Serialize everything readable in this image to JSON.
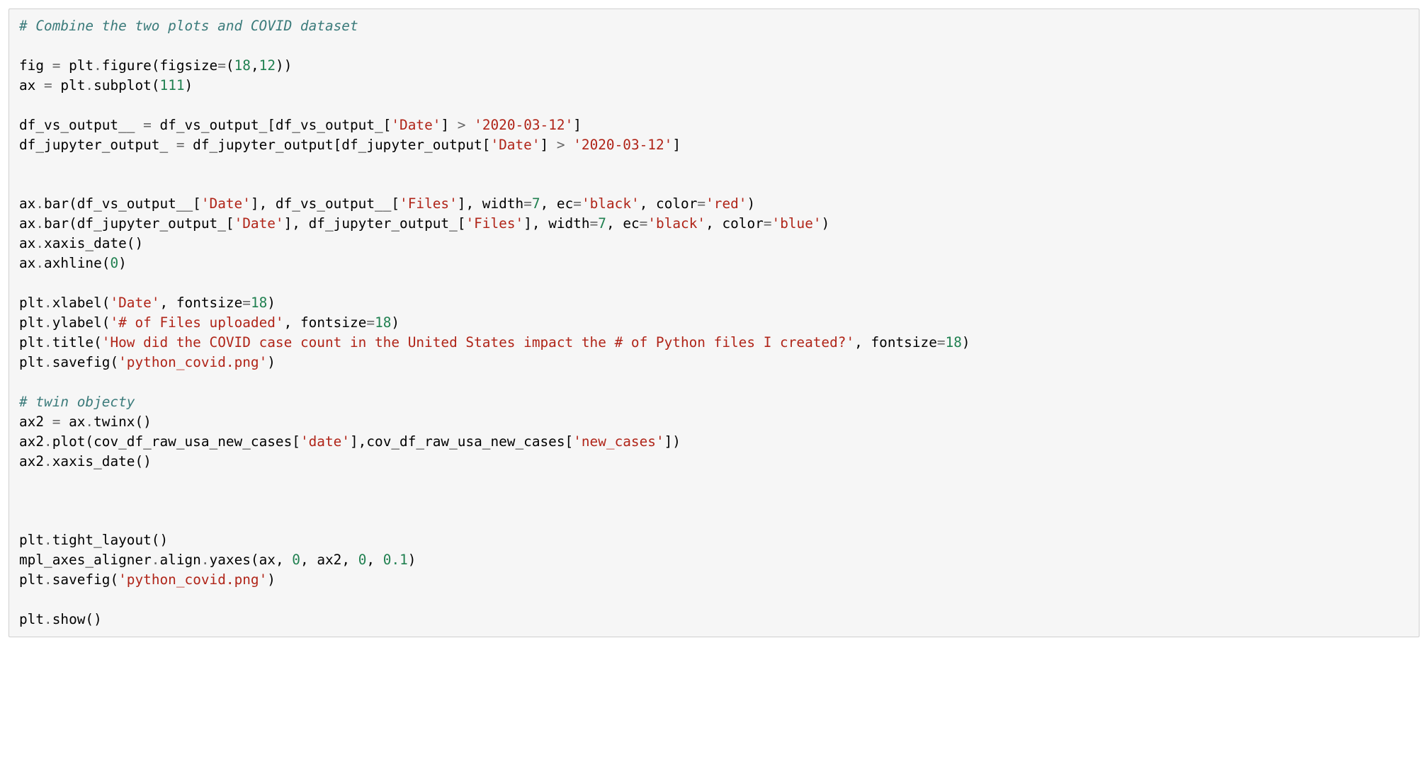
{
  "code": {
    "c1": "# Combine the two plots and COVID dataset",
    "l3a": "fig ",
    "l3op1": "=",
    "l3b": " plt",
    "l3dot1": ".",
    "l3c": "figure(figsize",
    "l3op2": "=",
    "l3p1": "(",
    "l3n1": "18",
    "l3cm": ",",
    "l3n2": "12",
    "l3p2": "))",
    "l4a": "ax ",
    "l4op1": "=",
    "l4b": " plt",
    "l4dot1": ".",
    "l4c": "subplot(",
    "l4n1": "111",
    "l4p": ")",
    "l6a": "df_vs_output__ ",
    "l6op1": "=",
    "l6b": " df_vs_output_[df_vs_output_[",
    "l6s1": "'Date'",
    "l6c": "] ",
    "l6op2": ">",
    "l6d": " ",
    "l6s2": "'2020-03-12'",
    "l6e": "]",
    "l7a": "df_jupyter_output_ ",
    "l7op1": "=",
    "l7b": " df_jupyter_output[df_jupyter_output[",
    "l7s1": "'Date'",
    "l7c": "] ",
    "l7op2": ">",
    "l7d": " ",
    "l7s2": "'2020-03-12'",
    "l7e": "]",
    "l10a": "ax",
    "l10dot1": ".",
    "l10b": "bar(df_vs_output__[",
    "l10s1": "'Date'",
    "l10c": "], df_vs_output__[",
    "l10s2": "'Files'",
    "l10d": "], width",
    "l10op1": "=",
    "l10n1": "7",
    "l10e": ", ec",
    "l10op2": "=",
    "l10s3": "'black'",
    "l10f": ", color",
    "l10op3": "=",
    "l10s4": "'red'",
    "l10g": ")",
    "l11a": "ax",
    "l11dot1": ".",
    "l11b": "bar(df_jupyter_output_[",
    "l11s1": "'Date'",
    "l11c": "], df_jupyter_output_[",
    "l11s2": "'Files'",
    "l11d": "], width",
    "l11op1": "=",
    "l11n1": "7",
    "l11e": ", ec",
    "l11op2": "=",
    "l11s3": "'black'",
    "l11f": ", color",
    "l11op3": "=",
    "l11s4": "'blue'",
    "l11g": ")",
    "l12a": "ax",
    "l12dot1": ".",
    "l12b": "xaxis_date()",
    "l13a": "ax",
    "l13dot1": ".",
    "l13b": "axhline(",
    "l13n1": "0",
    "l13c": ")",
    "l15a": "plt",
    "l15dot1": ".",
    "l15b": "xlabel(",
    "l15s1": "'Date'",
    "l15c": ", fontsize",
    "l15op1": "=",
    "l15n1": "18",
    "l15d": ")",
    "l16a": "plt",
    "l16dot1": ".",
    "l16b": "ylabel(",
    "l16s1": "'# of Files uploaded'",
    "l16c": ", fontsize",
    "l16op1": "=",
    "l16n1": "18",
    "l16d": ")",
    "l17a": "plt",
    "l17dot1": ".",
    "l17b": "title(",
    "l17s1": "'How did the COVID case count in the United States impact the # of Python files I created?'",
    "l17c": ", fontsize",
    "l17op1": "=",
    "l17n1": "18",
    "l17d": ")",
    "l18a": "plt",
    "l18dot1": ".",
    "l18b": "savefig(",
    "l18s1": "'python_covid.png'",
    "l18c": ")",
    "c2": "# twin objecty",
    "l21a": "ax2 ",
    "l21op1": "=",
    "l21b": " ax",
    "l21dot1": ".",
    "l21c": "twinx()",
    "l22a": "ax2",
    "l22dot1": ".",
    "l22b": "plot(cov_df_raw_usa_new_cases[",
    "l22s1": "'date'",
    "l22c": "],cov_df_raw_usa_new_cases[",
    "l22s2": "'new_cases'",
    "l22d": "])",
    "l23a": "ax2",
    "l23dot1": ".",
    "l23b": "xaxis_date()",
    "l27a": "plt",
    "l27dot1": ".",
    "l27b": "tight_layout()",
    "l28a": "mpl_axes_aligner",
    "l28dot1": ".",
    "l28b": "align",
    "l28dot2": ".",
    "l28c": "yaxes(ax, ",
    "l28n1": "0",
    "l28d": ", ax2, ",
    "l28n2": "0",
    "l28e": ", ",
    "l28n3": "0.1",
    "l28f": ")",
    "l29a": "plt",
    "l29dot1": ".",
    "l29b": "savefig(",
    "l29s1": "'python_covid.png'",
    "l29c": ")",
    "l31a": "plt",
    "l31dot1": ".",
    "l31b": "show()"
  }
}
